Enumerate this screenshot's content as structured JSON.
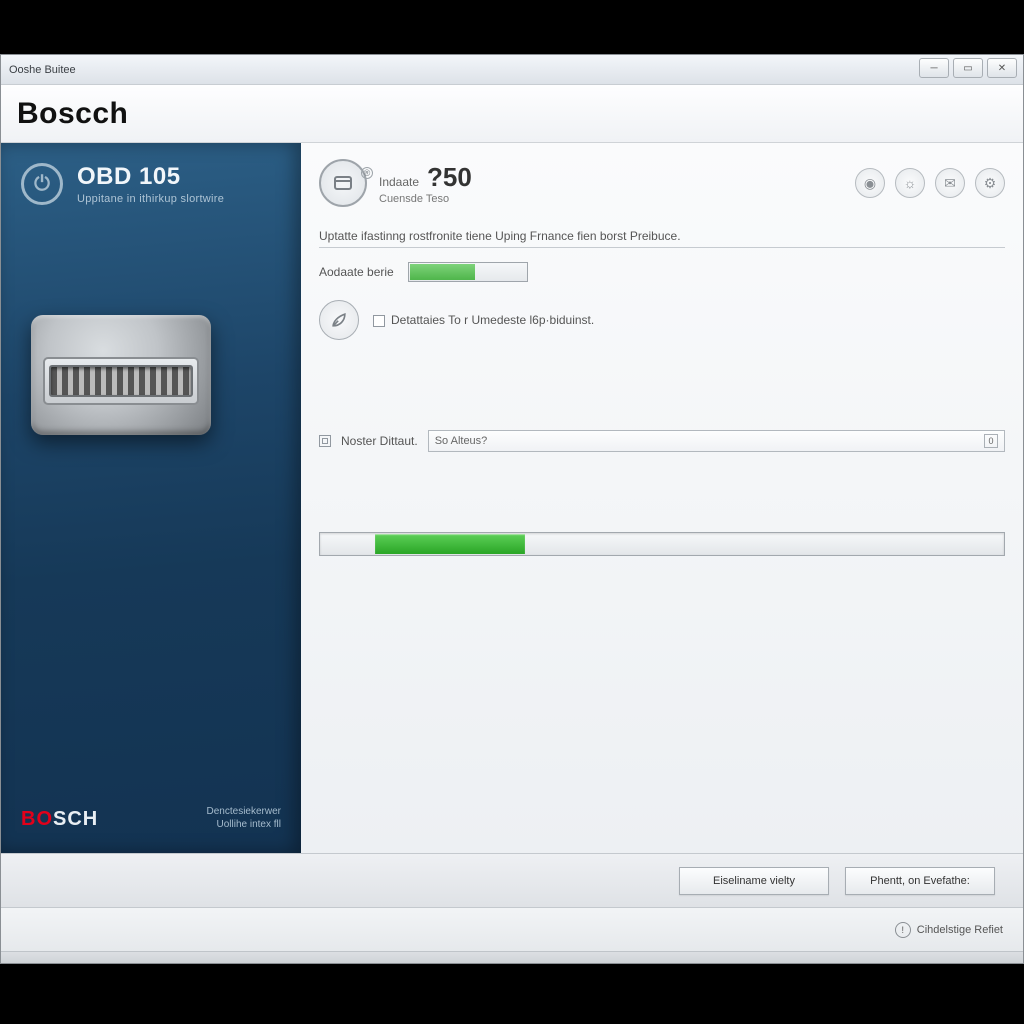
{
  "titlebar": {
    "title": "Ooshe Buitee"
  },
  "brand": {
    "name": "Boscch"
  },
  "sidebar": {
    "ring_glyph": "⏻",
    "title": "OBD 105",
    "subtitle": "Uppitane in ithirkup slortwire",
    "footer_logo_red": "BO",
    "footer_logo_white": "SCH",
    "footer_line1": "Denctesiekerwer",
    "footer_line2": "Uollihe intex fll"
  },
  "main": {
    "header_small1": "Indaate",
    "header_small2": "Cuensde Teso",
    "header_num": "?50",
    "section_title": "Uptatte ifastinng rostfronite tiene Uping Frnance fien borst Preibuce.",
    "row1_label": "Aodaate berie",
    "row2_text": "Detattaies To r Umedeste l6p·biduinst.",
    "field_label": "Noster Dittaut.",
    "field_value": "So Alteus?",
    "field_end": "0"
  },
  "buttons": {
    "left": "Eiseliname vielty",
    "right": "Phentt, on   Evefathe:"
  },
  "status": {
    "text": "Cihdelstige Refiet"
  },
  "progress": {
    "mini_percent": 55,
    "big_left_percent": 8,
    "big_width_percent": 22
  }
}
